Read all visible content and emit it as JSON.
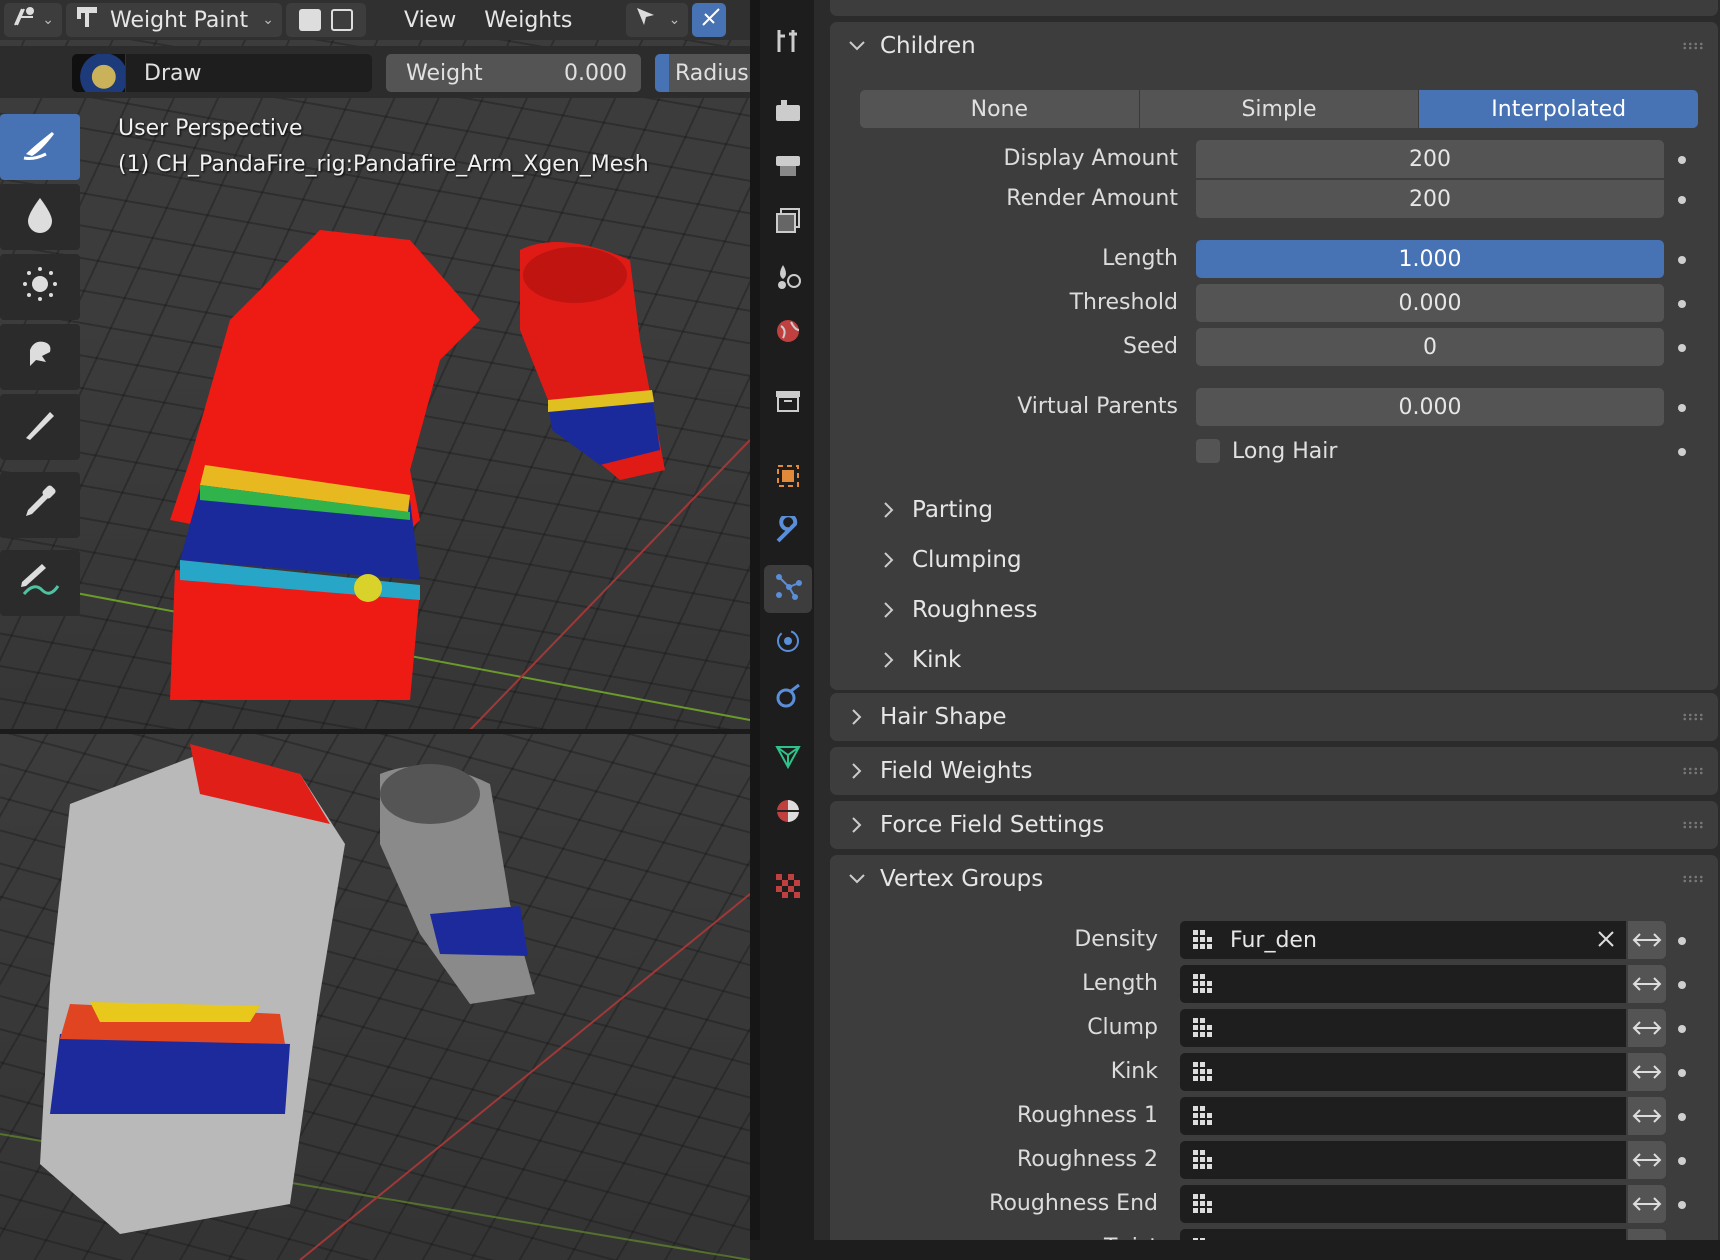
{
  "viewport": {
    "header": {
      "mode": "Weight Paint",
      "menus": [
        "View",
        "Weights"
      ]
    },
    "tool_settings": {
      "brush_name": "Draw",
      "weight_label": "Weight",
      "weight_value": "0.000",
      "radius_label": "Radius"
    },
    "overlay": {
      "view_name": "User Perspective",
      "object_name": "(1) CH_PandaFire_rig:Pandafire_Arm_Xgen_Mesh"
    },
    "toolbox": [
      "draw-brush-icon",
      "blur-brush-icon",
      "average-brush-icon",
      "smear-brush-icon",
      "gradient-icon",
      "sample-weight-icon",
      "annotate-icon"
    ]
  },
  "properties": {
    "tabs": [
      "tool-icon",
      "render-icon",
      "output-icon",
      "view-layer-icon",
      "scene-icon",
      "world-icon",
      "collection-icon",
      "object-icon",
      "modifier-icon",
      "particles-icon",
      "physics-icon",
      "constraints-icon",
      "data-icon",
      "material-icon",
      "texture-icon"
    ],
    "children": {
      "title": "Children",
      "modes": [
        "None",
        "Simple",
        "Interpolated"
      ],
      "selected_mode": "Interpolated",
      "display_amount_label": "Display Amount",
      "display_amount": "200",
      "render_amount_label": "Render Amount",
      "render_amount": "200",
      "length_label": "Length",
      "length": "1.000",
      "threshold_label": "Threshold",
      "threshold": "0.000",
      "seed_label": "Seed",
      "seed": "0",
      "virtual_parents_label": "Virtual Parents",
      "virtual_parents": "0.000",
      "long_hair_label": "Long Hair",
      "long_hair": false,
      "subpanels": [
        "Parting",
        "Clumping",
        "Roughness",
        "Kink"
      ]
    },
    "collapsed_panels": [
      "Hair Shape",
      "Field Weights",
      "Force Field Settings"
    ],
    "vertex_groups": {
      "title": "Vertex Groups",
      "rows": [
        {
          "label": "Density",
          "value": "Fur_den"
        },
        {
          "label": "Length",
          "value": ""
        },
        {
          "label": "Clump",
          "value": ""
        },
        {
          "label": "Kink",
          "value": ""
        },
        {
          "label": "Roughness 1",
          "value": ""
        },
        {
          "label": "Roughness 2",
          "value": ""
        },
        {
          "label": "Roughness End",
          "value": ""
        },
        {
          "label": "Twist",
          "value": ""
        }
      ]
    }
  },
  "colors": {
    "accent": "#4772b3",
    "panel": "#3d3d3d",
    "field": "#545454",
    "background": "#2b2b2b"
  }
}
